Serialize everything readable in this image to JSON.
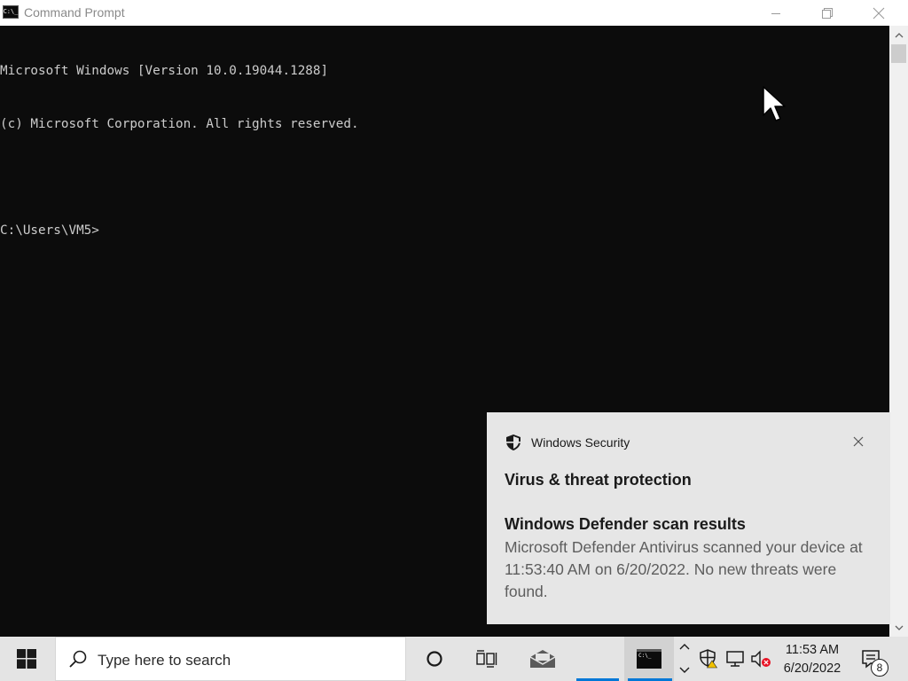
{
  "window": {
    "title": "Command Prompt",
    "icon_text": "C:\\_"
  },
  "console": {
    "lines": [
      "Microsoft Windows [Version 10.0.19044.1288]",
      "(c) Microsoft Corporation. All rights reserved.",
      "",
      "C:\\Users\\VM5>"
    ]
  },
  "toast": {
    "app_name": "Windows Security",
    "heading": "Virus & threat protection",
    "title": "Windows Defender scan results",
    "body": "Microsoft Defender Antivirus scanned your device at 11:53:40 AM on 6/20/2022. No new threats were found."
  },
  "taskbar": {
    "search_placeholder": "Type here to search",
    "clock_time": "11:53 AM",
    "clock_date": "6/20/2022",
    "notification_count": "8",
    "cmd_tile_text": "C:\\_"
  },
  "colors": {
    "console_bg": "#0c0c0c",
    "console_text": "#cccccc",
    "toast_bg": "#e6e6e6",
    "taskbar_bg": "#e4e4e4",
    "accent": "#0078d7"
  },
  "icons": [
    "command-prompt-icon",
    "minimize-icon",
    "maximize-icon",
    "close-icon",
    "scroll-up-icon",
    "scroll-down-icon",
    "mouse-cursor-icon",
    "shield-icon",
    "windows-logo-icon",
    "search-icon",
    "cortana-icon",
    "task-view-icon",
    "mail-icon",
    "chevron-up-icon",
    "chevron-down-icon",
    "security-shield-warning-icon",
    "network-icon",
    "volume-muted-icon",
    "action-center-icon"
  ]
}
